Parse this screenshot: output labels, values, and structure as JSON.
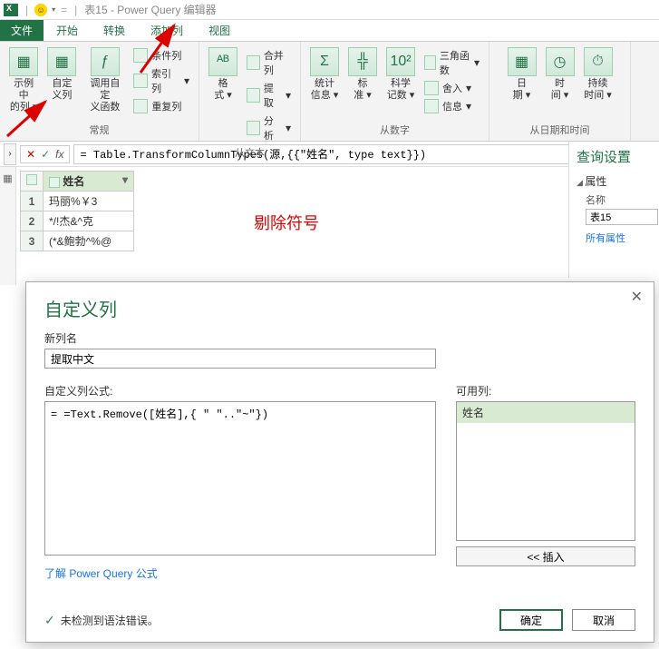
{
  "title": {
    "app_icon": "XⅡ",
    "window": "表15 - Power Query 编辑器"
  },
  "tabs": {
    "file": "文件",
    "home": "开始",
    "transform": "转换",
    "addcol": "添加列",
    "view": "视图"
  },
  "ribbon": {
    "group1": {
      "btn1a": "示例中",
      "btn1b": "的列",
      "btn2a": "自定",
      "btn2b": "义列",
      "btn3a": "调用自定",
      "btn3b": "义函数",
      "cond": "条件列",
      "index": "索引列",
      "dup": "重复列",
      "label": "常规"
    },
    "group2": {
      "format_a": "格",
      "format_b": "式",
      "merge": "合并列",
      "extract": "提取",
      "analyze": "分析",
      "label": "从文本"
    },
    "group3": {
      "stat_a": "统计",
      "stat_b": "信息",
      "std_a": "标",
      "std_b": "准",
      "sci_a": "科学",
      "sci_b": "记数",
      "trig": "三角函数",
      "round": "舍入",
      "info": "信息",
      "label": "从数字"
    },
    "group4": {
      "date_a": "日",
      "date_b": "期",
      "time_a": "时",
      "time_b": "间",
      "dur_a": "持续",
      "dur_b": "时间",
      "label": "从日期和时间"
    }
  },
  "formula": {
    "fx": "fx",
    "value": "= Table.TransformColumnTypes(源,{{\"姓名\", type text}})"
  },
  "grid": {
    "col1": "姓名",
    "rows": [
      "玛丽%￥3",
      "*/!杰&^克",
      "(*&鲍勃^%@"
    ]
  },
  "annotation": "剔除符号",
  "right": {
    "title": "查询设置",
    "section": "属性",
    "name_label": "名称",
    "name_value": "表15",
    "all_props": "所有属性"
  },
  "dialog": {
    "title": "自定义列",
    "new_col_label": "新列名",
    "new_col_value": "提取中文",
    "formula_label": "自定义列公式:",
    "formula_value": "= =Text.Remove([姓名],{ \" \"..\"~\"})",
    "available_label": "可用列:",
    "available_item": "姓名",
    "insert": "<< 插入",
    "learn": "了解 Power Query 公式",
    "status": "未检测到语法错误。",
    "ok": "确定",
    "cancel": "取消"
  }
}
